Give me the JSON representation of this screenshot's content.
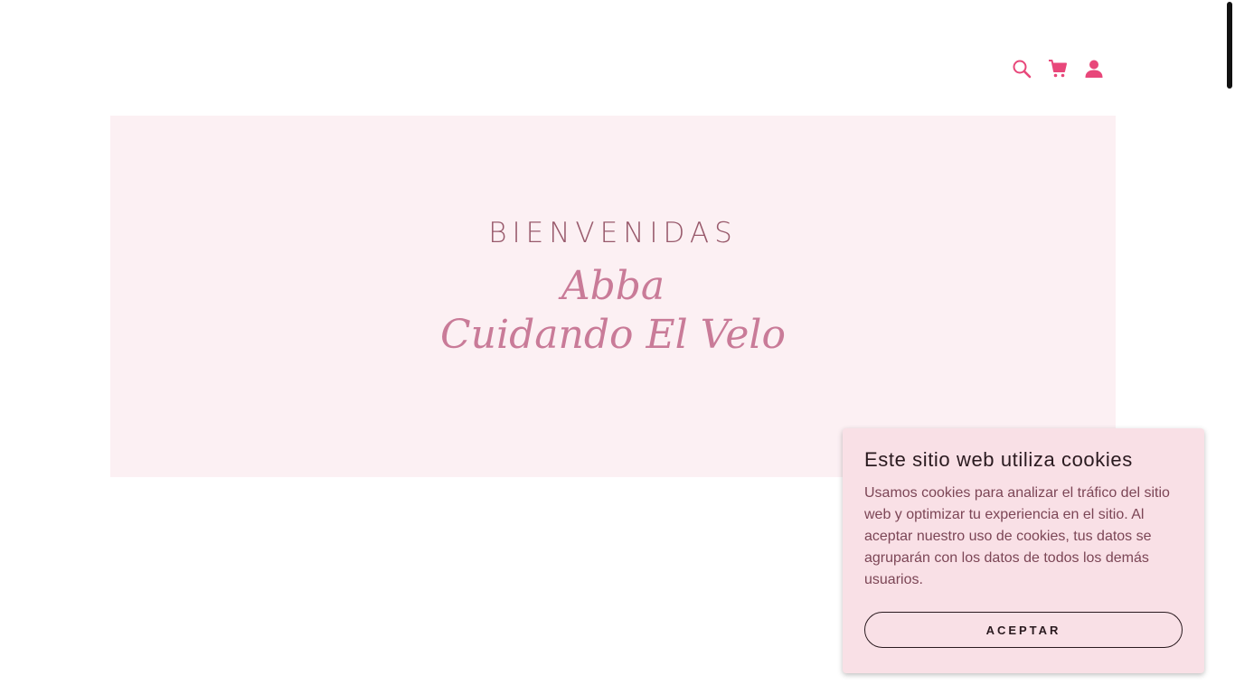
{
  "header": {
    "icons": {
      "search": "search-icon",
      "cart": "cart-icon",
      "account": "user-icon"
    },
    "icon_color": "#e8477a"
  },
  "hero": {
    "eyebrow": "BIENVENIDAS",
    "title_line1": "Abba",
    "title_line2": "Cuidando El Velo",
    "background": "#fcf0f3",
    "title_color": "#c97b98"
  },
  "cookie_banner": {
    "title": "Este sitio web utiliza cookies",
    "body": "Usamos cookies para analizar el tráfico del sitio web y optimizar tu experiencia en el sitio. Al aceptar nuestro uso de cookies, tus datos se agruparán con los datos de todos los demás usuarios.",
    "accept_label": "ACEPTAR",
    "background": "#f9e0e6"
  }
}
